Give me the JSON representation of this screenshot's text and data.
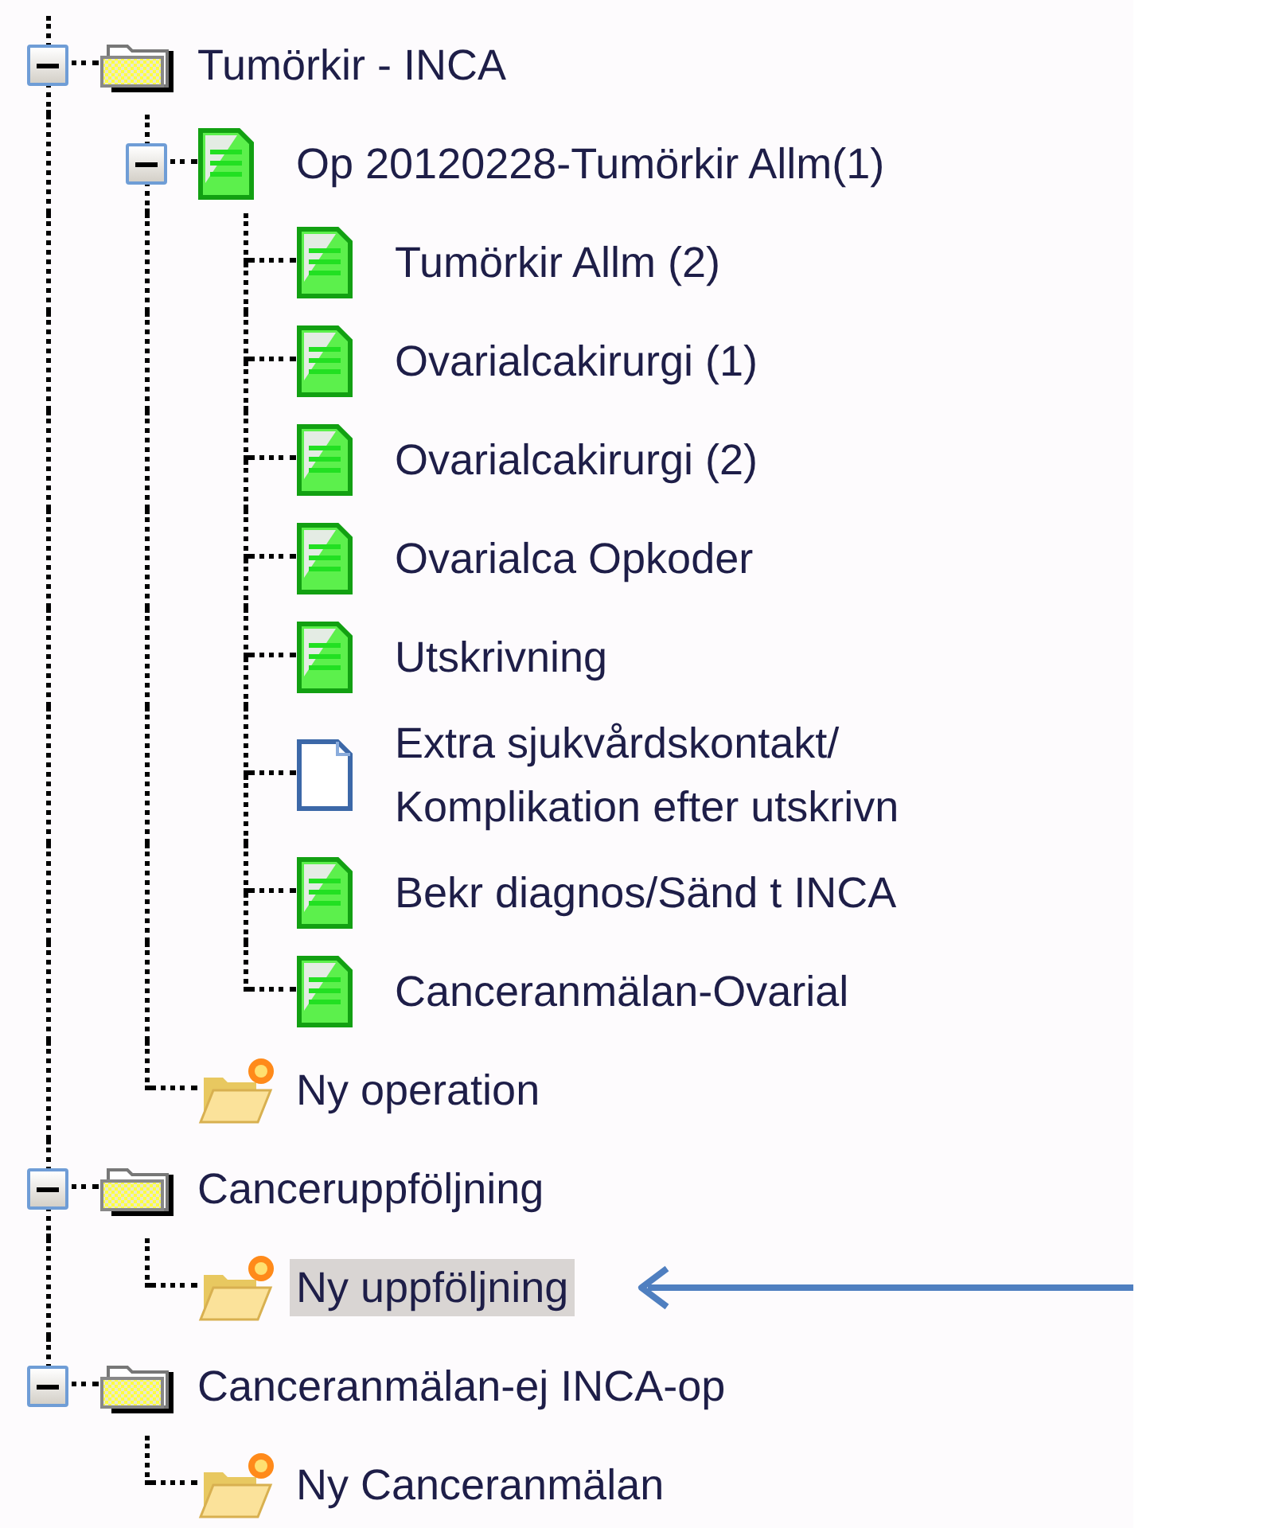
{
  "tree": [
    {
      "label": "Tumörkir - INCA",
      "kind": "folder",
      "expanded": true,
      "selected": false,
      "children": [
        {
          "label": "Op 20120228-Tumörkir Allm(1)",
          "kind": "document",
          "expanded": true,
          "selected": false,
          "children": [
            {
              "label": "Tumörkir Allm (2)",
              "kind": "document",
              "selected": false
            },
            {
              "label": "Ovarialcakirurgi (1)",
              "kind": "document",
              "selected": false
            },
            {
              "label": "Ovarialcakirurgi (2)",
              "kind": "document",
              "selected": false
            },
            {
              "label": "Ovarialca Opkoder",
              "kind": "document",
              "selected": false
            },
            {
              "label": "Utskrivning",
              "kind": "document",
              "selected": false
            },
            {
              "label": "Extra sjukvårdskontakt/\nKomplikation efter utskrivn",
              "kind": "blank-document",
              "selected": false
            },
            {
              "label": "Bekr diagnos/Sänd t INCA",
              "kind": "document",
              "selected": false
            },
            {
              "label": "Canceranmälan-Ovarial",
              "kind": "document",
              "selected": false
            }
          ]
        },
        {
          "label": "Ny operation",
          "kind": "new-folder",
          "selected": false
        }
      ]
    },
    {
      "label": "Canceruppföljning",
      "kind": "folder",
      "expanded": true,
      "selected": false,
      "children": [
        {
          "label": "Ny uppföljning",
          "kind": "new-folder",
          "selected": true
        }
      ]
    },
    {
      "label": "Canceranmälan-ej INCA-op",
      "kind": "folder",
      "expanded": true,
      "selected": false,
      "children": [
        {
          "label": "Ny Canceranmälan",
          "kind": "new-folder",
          "selected": false
        }
      ]
    }
  ]
}
